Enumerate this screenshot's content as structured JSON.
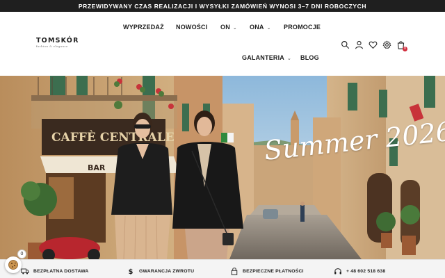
{
  "announcement": "PRZEWIDYWANY CZAS REALIZACJI I WYSYŁKI ZAMÓWIEŃ WYNOSI 3–7 DNI ROBOCZYCH",
  "logo": {
    "name": "TOMSKÓR",
    "tagline": "fashion & elegance"
  },
  "nav": {
    "sale": "WYPRZEDAŻ",
    "new": "NOWOŚCI",
    "him": "ON",
    "her": "ONA",
    "promo": "PROMOCJE",
    "gallery": "GALANTERIA",
    "blog": "BLOG"
  },
  "header_icons": [
    "search-icon",
    "user-icon",
    "heart-icon",
    "gear-icon",
    "cart-icon"
  ],
  "cart_count": "0",
  "hero": {
    "headline": "Summer 2026",
    "sign": "CAFFÈ CENTRALE",
    "sign_year": "1928",
    "bar": "BAR"
  },
  "benefits": [
    {
      "label": "BEZPŁATNA DOSTAWA",
      "icon": "truck-icon"
    },
    {
      "label": "GWARANCJA ZWROTU",
      "icon": "dollar-icon"
    },
    {
      "label": "BEZPIECZNE PŁATNOŚCI",
      "icon": "lock-icon"
    },
    {
      "label": "+ 48 602 518 638",
      "icon": "headset-icon"
    }
  ],
  "cookie_badge": "0",
  "colors": {
    "dark": "#1f1f1f",
    "accent_red": "#d12b3b",
    "benefits_bg": "#f4f4f4"
  }
}
